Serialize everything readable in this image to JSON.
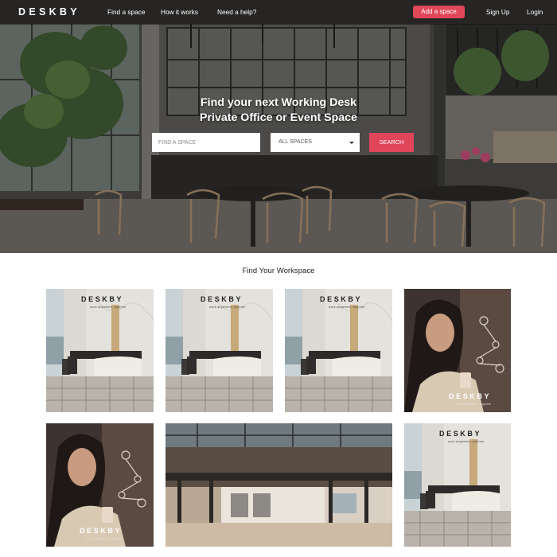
{
  "navbar": {
    "logo": "DESKBY",
    "links": [
      "Find a space",
      "How it works",
      "Need a help?"
    ],
    "add_space": "Add a space",
    "sign_up": "Sign Up",
    "login": "Login"
  },
  "hero": {
    "headline_line1": "Find your next Working Desk",
    "headline_line2": "Private Office or Event Space",
    "search_placeholder": "FIND A SPACE",
    "space_type_selected": "ALL SPACES",
    "search_button": "SEARCH"
  },
  "workspaces": {
    "title": "Find Your Workspace",
    "brand": "DESKBY",
    "tagline": "work anywhere, anytime"
  },
  "colors": {
    "accent": "#e0485a",
    "nav_bg": "#141414"
  }
}
